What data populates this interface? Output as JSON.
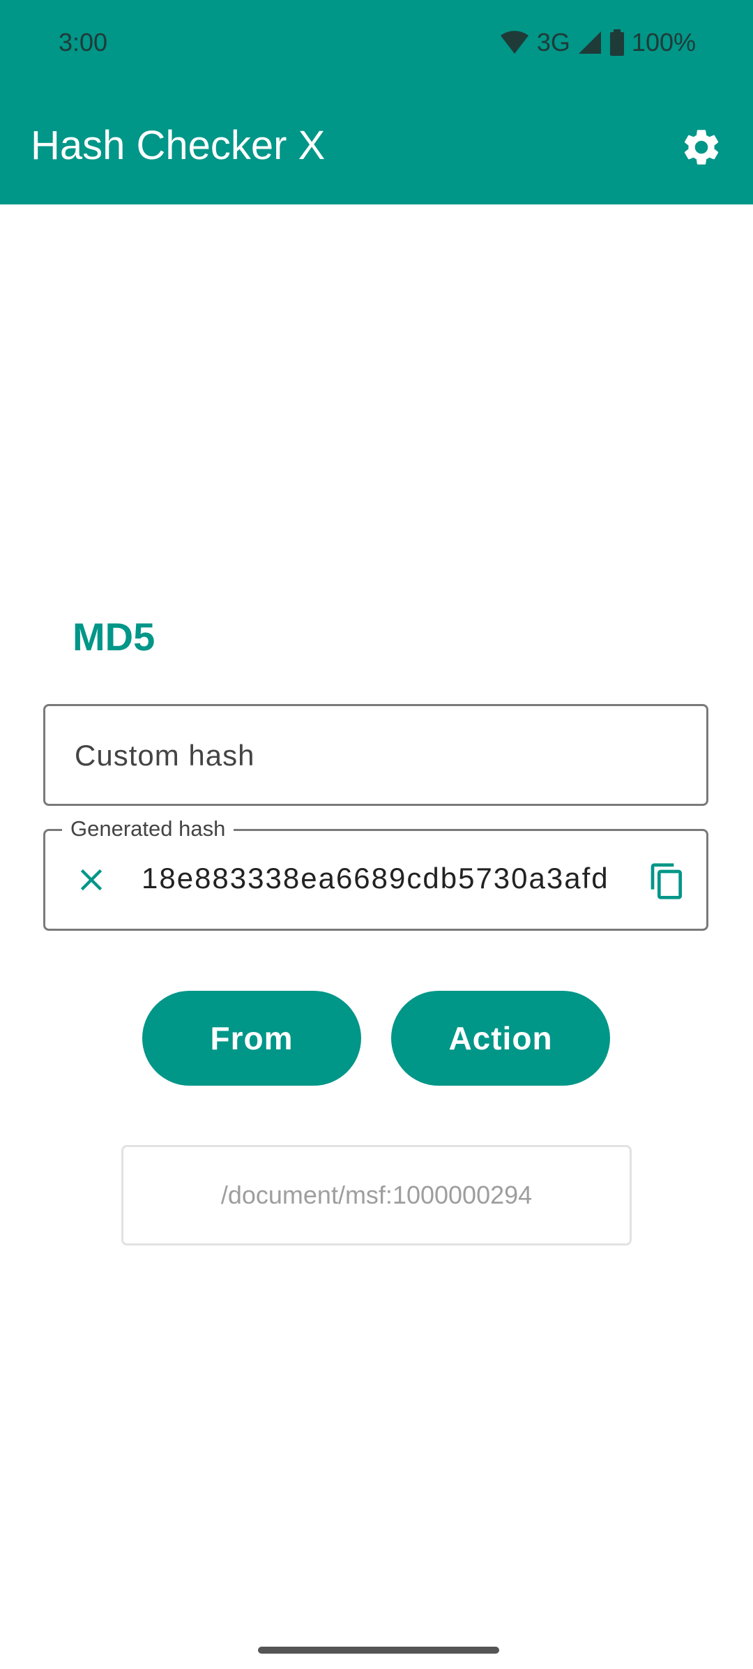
{
  "status_bar": {
    "time": "3:00",
    "network": "3G",
    "battery": "100%",
    "icons": [
      "wifi-icon",
      "cell-signal-icon",
      "battery-icon"
    ]
  },
  "app_bar": {
    "title": "Hash Checker X",
    "settings_icon": "gear-icon"
  },
  "main": {
    "algorithm": "MD5",
    "custom_hash": {
      "value": "",
      "placeholder": "Custom hash"
    },
    "generated_hash": {
      "label": "Generated hash",
      "value": "18e883338ea6689cdb5730a3afd",
      "clear_icon": "close-icon",
      "copy_icon": "copy-icon"
    },
    "buttons": {
      "from": "From",
      "action": "Action"
    },
    "file_path": "/document/msf:1000000294"
  },
  "colors": {
    "primary": "#009688",
    "on_primary": "#ffffff",
    "outline": "#7a7a7a"
  }
}
